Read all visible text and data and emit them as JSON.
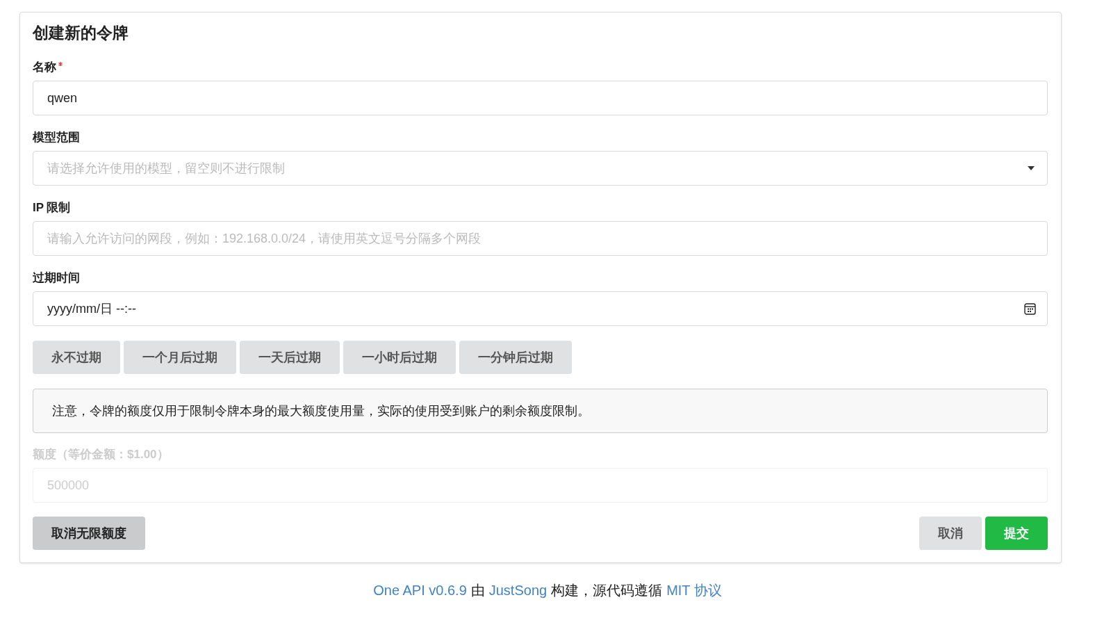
{
  "title": "创建新的令牌",
  "fields": [
    {
      "kind": "text",
      "label": "名称",
      "required": true,
      "value": "qwen"
    },
    {
      "kind": "select",
      "label": "模型范围",
      "required": false,
      "placeholder": "请选择允许使用的模型，留空则不进行限制"
    },
    {
      "kind": "text",
      "label": "IP 限制",
      "required": false,
      "placeholder": "请输入允许访问的网段，例如：192.168.0.0/24，请使用英文逗号分隔多个网段"
    },
    {
      "kind": "datetime",
      "label": "过期时间",
      "required": false,
      "value": "yyyy/mm/日 --:--"
    }
  ],
  "expire_buttons": [
    "永不过期",
    "一个月后过期",
    "一天后过期",
    "一小时后过期",
    "一分钟后过期"
  ],
  "notice": "注意，令牌的额度仅用于限制令牌本身的最大额度使用量，实际的使用受到账户的剩余额度限制。",
  "quota": {
    "label": "额度（等价金额：$1.00）",
    "placeholder": "500000",
    "disabled": true
  },
  "unlimited_button": "取消无限额度",
  "buttons": [
    {
      "kind": "secondary",
      "label": "取消"
    },
    {
      "kind": "primary",
      "label": "提交"
    }
  ],
  "footer": [
    {
      "kind": "link",
      "text": "One API v0.6.9"
    },
    {
      "kind": "text",
      "text": "由"
    },
    {
      "kind": "link",
      "text": "JustSong"
    },
    {
      "kind": "text",
      "text": "构建，源代码遵循"
    },
    {
      "kind": "link",
      "text": "MIT 协议"
    }
  ]
}
